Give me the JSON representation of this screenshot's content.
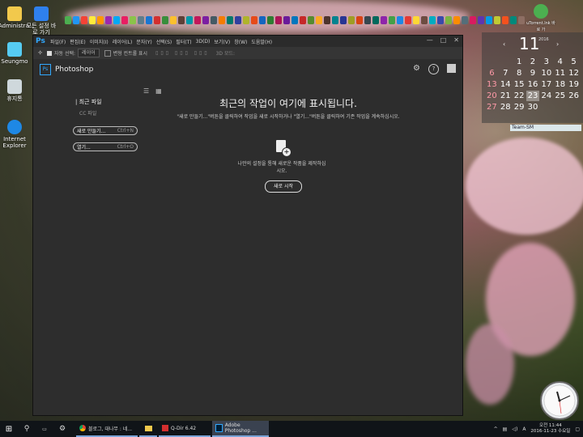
{
  "desktop_icons": [
    {
      "label": "Administra..."
    },
    {
      "label": "모든 설정 바로 가기"
    },
    {
      "label": "Seungmo"
    },
    {
      "label": "휴지통"
    },
    {
      "label": "Internet Explorer"
    }
  ],
  "utorrent_label": "uTorrent.lnk 바로 가",
  "photoshop": {
    "window_logo": "Ps",
    "menu": [
      "파일(F)",
      "편집(E)",
      "이미지(I)",
      "레이어(L)",
      "문자(Y)",
      "선택(S)",
      "필터(T)",
      "3D(D)",
      "보기(V)",
      "창(W)",
      "도움말(H)"
    ],
    "window_controls": [
      "—",
      "□",
      "✕"
    ],
    "options": {
      "auto_select_label": "자동 선택:",
      "layer_select": "레이어",
      "transform_label": "변형 컨트롤 표시",
      "mode_3d": "3D 모드:"
    },
    "home": {
      "badge": "Ps",
      "title": "Photoshop",
      "recent_label": "최근 파일",
      "cc_label": "CC 파일",
      "new_button": {
        "label": "새로 만들기...",
        "shortcut": "Ctrl+N"
      },
      "open_button": {
        "label": "열기...",
        "shortcut": "Ctrl+O"
      },
      "main_title": "최근의 작업이 여기에 표시됩니다.",
      "main_desc": "\"새로 만들기...\"버튼을 클릭하여 작업을 새로 시작하거나 \"열기...\"버튼을 클릭하여 기존 작업을 계속하십시오.",
      "doc_desc": "나만의 설정을 통해 새로운 작품을 제작하십시오.",
      "start_button": "새로 시작"
    }
  },
  "calendar": {
    "month": "11",
    "year": "2016",
    "days": [
      "",
      "",
      "1",
      "2",
      "3",
      "4",
      "5",
      "6",
      "7",
      "8",
      "9",
      "10",
      "11",
      "12",
      "13",
      "14",
      "15",
      "16",
      "17",
      "18",
      "19",
      "20",
      "21",
      "22",
      "23",
      "24",
      "25",
      "26",
      "27",
      "28",
      "29",
      "30",
      "",
      "",
      ""
    ]
  },
  "team_sm_label": "Team-SM",
  "taskbar": {
    "apps": [
      {
        "label": "블로그, 대나무 : 네..."
      },
      {
        "label": ""
      },
      {
        "label": "Q-Dir 6.42"
      },
      {
        "label": "Adobe Photoshop ..."
      }
    ],
    "ime": "A",
    "time": "오전 11:44",
    "date": "2016-11-23 수요일"
  },
  "colors": {
    "ps_blue": "#31a8ff",
    "ps_bg": "#2d2d2d",
    "taskbar": "#101418"
  }
}
